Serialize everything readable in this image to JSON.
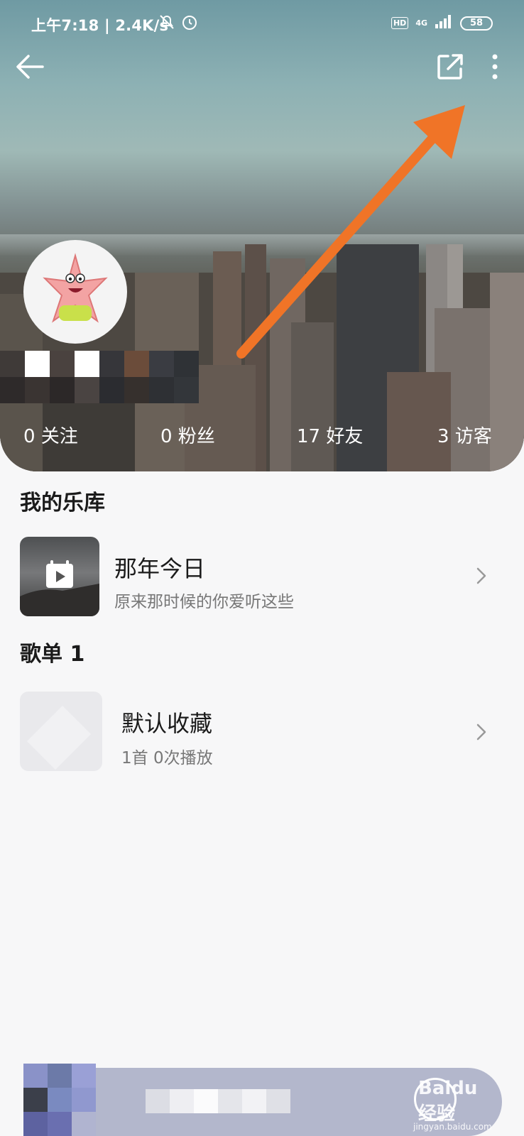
{
  "status_bar": {
    "time": "上午7:18 | 2.4K/s",
    "hd": "HD",
    "network": "4G",
    "battery": "58"
  },
  "profile": {
    "stats": [
      {
        "label": "0 关注"
      },
      {
        "label": "0 粉丝"
      },
      {
        "label": "17 好友"
      },
      {
        "label": "3 访客"
      }
    ]
  },
  "library": {
    "title": "我的乐库",
    "item": {
      "title": "那年今日",
      "subtitle": "原来那时候的你爱听这些"
    }
  },
  "playlists": {
    "title": "歌单 1",
    "item": {
      "title": "默认收藏",
      "subtitle": "1首  0次播放"
    }
  },
  "watermark": {
    "brand": "Baidu 经验",
    "url": "jingyan.baidu.com"
  },
  "colors": {
    "annotation_arrow": "#f07427",
    "background": "#f7f7f8"
  }
}
